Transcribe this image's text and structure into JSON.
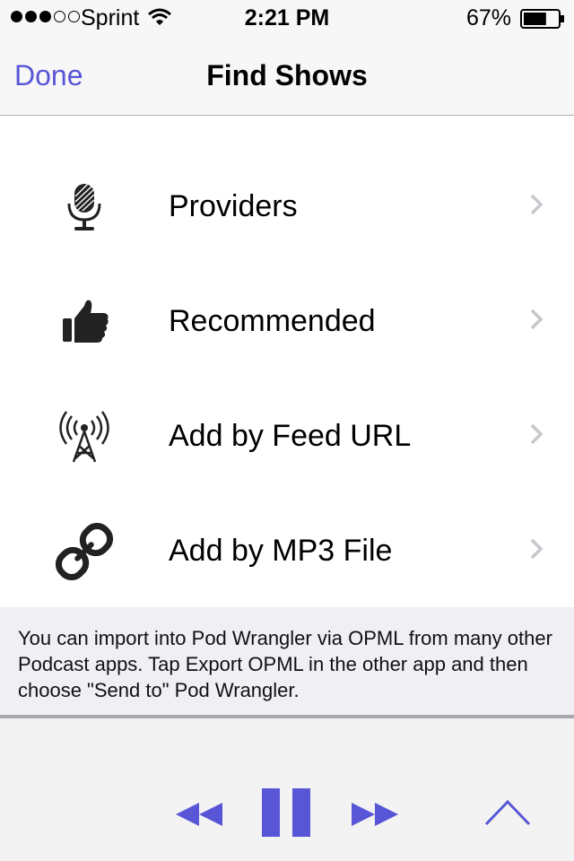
{
  "status_bar": {
    "carrier": "Sprint",
    "time": "2:21 PM",
    "battery_percent": "67%",
    "battery_level": 0.67,
    "signal_bars_filled": 3,
    "signal_bars_total": 5
  },
  "nav_bar": {
    "done_label": "Done",
    "title": "Find Shows"
  },
  "menu": {
    "items": [
      {
        "label": "Providers",
        "icon": "microphone-icon"
      },
      {
        "label": "Recommended",
        "icon": "thumbs-up-icon"
      },
      {
        "label": "Add by Feed URL",
        "icon": "antenna-icon"
      },
      {
        "label": "Add by MP3 File",
        "icon": "link-icon"
      }
    ]
  },
  "info": {
    "text": "You can import into Pod Wrangler via OPML from many other Podcast apps.  Tap Export OPML in the other app and then choose \"Send to\" Pod Wrangler."
  },
  "player": {
    "controls": [
      "rewind-icon",
      "pause-icon",
      "fast-forward-icon",
      "chevron-up-icon"
    ]
  },
  "colors": {
    "accent": "#5856d6",
    "chevron": "#c7c7cc",
    "info_background": "#efeff4"
  }
}
